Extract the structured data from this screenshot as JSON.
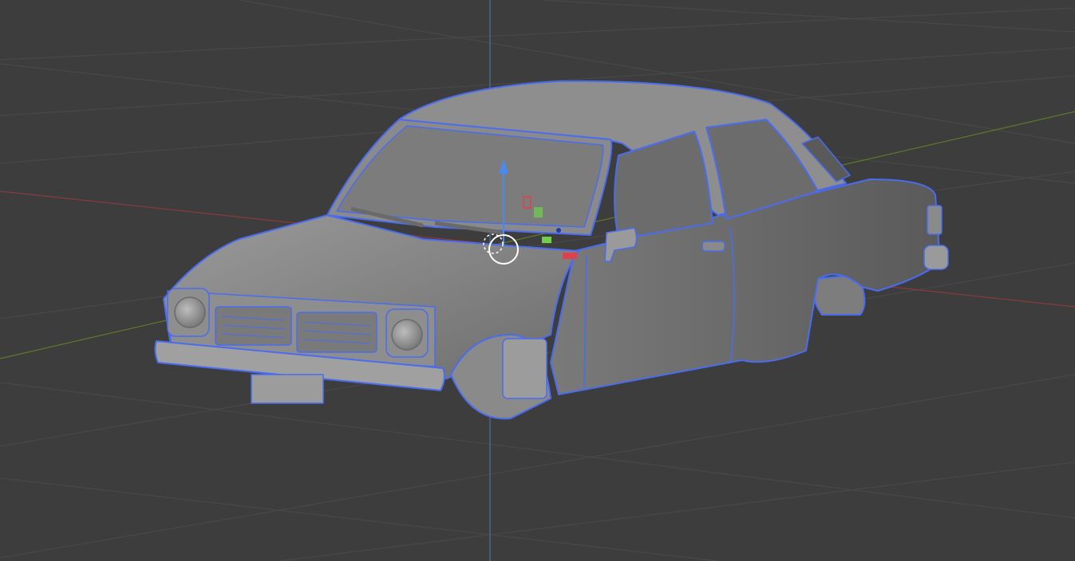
{
  "viewport": {
    "background": "#3d3d3d",
    "grid_color": "#4a4a4a",
    "x_axis_color": "#8a3b3b",
    "y_axis_color": "#5c7a2a",
    "z_axis_color": "#4d6fa3"
  },
  "model": {
    "body_color": "#8c8c8c",
    "outline_color": "#4a6cf0",
    "glass_color": "#6c6c6c"
  },
  "gizmo": {
    "x_color": "#e0404a",
    "y_color": "#6fd04a",
    "z_color": "#4a8af0",
    "origin_icon": "crosshair-circle-icon"
  }
}
